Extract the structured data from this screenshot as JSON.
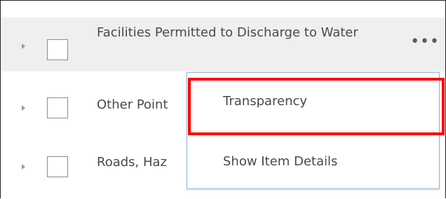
{
  "layers": [
    {
      "label": "Facilities Permitted to Discharge to Water",
      "checked": false,
      "expanded": false,
      "more_icon": "ellipsis-icon"
    },
    {
      "label": "Other Point",
      "checked": false,
      "expanded": false
    },
    {
      "label": "Roads, Haz",
      "checked": false,
      "expanded": false
    }
  ],
  "more_glyph": "•••",
  "context_menu": {
    "items": [
      {
        "label": "Transparency",
        "highlighted": true
      },
      {
        "label": "Show Item Details",
        "highlighted": false
      }
    ]
  },
  "colors": {
    "highlight_border": "#ff0000",
    "menu_border": "#8cb8d8",
    "hover_row": "#efefef"
  }
}
